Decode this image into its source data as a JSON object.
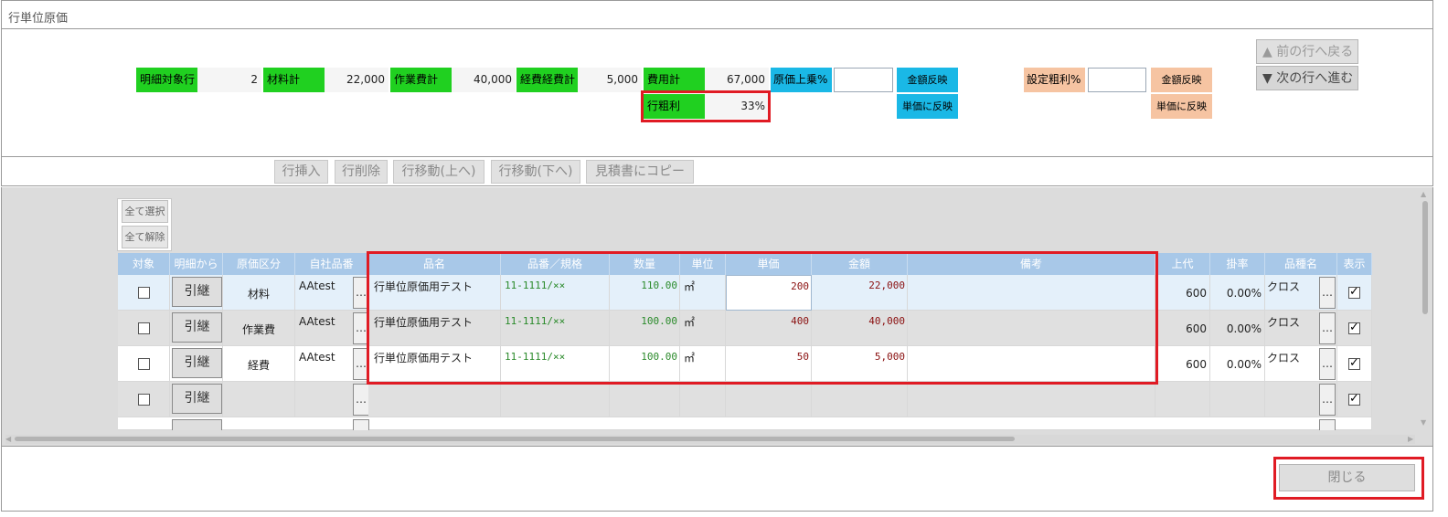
{
  "window": {
    "title": "行単位原価"
  },
  "summary": {
    "detail_rows_label": "明細対象行",
    "detail_rows_value": "2",
    "material_label": "材料計",
    "material_value": "22,000",
    "labor_label": "作業費計",
    "labor_value": "40,000",
    "expense_label": "経費経費計",
    "expense_value": "5,000",
    "cost_total_label": "費用計",
    "cost_total_value": "67,000",
    "markup_label": "原価上乗%",
    "markup_value": "",
    "amount_reflect_label": "金額反映",
    "unit_reflect_label": "単価に反映",
    "gross_label": "行粗利",
    "gross_value": "33%",
    "target_margin_label": "設定粗利%",
    "target_margin_value": "",
    "amount_reflect2_label": "金額反映",
    "unit_reflect2_label": "単価に反映",
    "prev_row_label": "▲ 前の行へ戻る",
    "next_row_label": "▼ 次の行へ進む"
  },
  "toolbar": {
    "insert_label": "行挿入",
    "delete_label": "行削除",
    "move_up_label": "行移動(上へ)",
    "move_down_label": "行移動(下へ)",
    "copy_label": "見積書にコピー"
  },
  "selection": {
    "select_all": "全て選択",
    "deselect_all": "全て解除"
  },
  "grid": {
    "headers": {
      "target": "対象",
      "from_detail": "明細から",
      "cost_type": "原価区分",
      "own_code": "自社品番",
      "name": "品名",
      "spec": "品番／規格",
      "qty": "数量",
      "unit": "単位",
      "unit_price": "単価",
      "amount": "金額",
      "note": "備考",
      "list_price": "上代",
      "rate": "掛率",
      "category": "品種名",
      "show": "表示"
    },
    "rows": [
      {
        "btn": "引継",
        "cost_type": "材料",
        "own_code": "AAtest",
        "dots": "…",
        "name": "行単位原価用テスト",
        "spec": "11-1111/××",
        "qty": "110.00",
        "unit": "㎡",
        "unit_price": "200",
        "amount": "22,000",
        "note": "",
        "list_price": "600",
        "rate": "0.00%",
        "category": "クロス",
        "dots2": "…"
      },
      {
        "btn": "引継",
        "cost_type": "作業費",
        "own_code": "AAtest",
        "dots": "…",
        "name": "行単位原価用テスト",
        "spec": "11-1111/××",
        "qty": "100.00",
        "unit": "㎡",
        "unit_price": "400",
        "amount": "40,000",
        "note": "",
        "list_price": "600",
        "rate": "0.00%",
        "category": "クロス",
        "dots2": "…"
      },
      {
        "btn": "引継",
        "cost_type": "経費",
        "own_code": "AAtest",
        "dots": "…",
        "name": "行単位原価用テスト",
        "spec": "11-1111/××",
        "qty": "100.00",
        "unit": "㎡",
        "unit_price": "50",
        "amount": "5,000",
        "note": "",
        "list_price": "600",
        "rate": "0.00%",
        "category": "クロス",
        "dots2": "…"
      },
      {
        "btn": "引継",
        "cost_type": "",
        "own_code": "",
        "dots": "…",
        "name": "",
        "spec": "",
        "qty": "",
        "unit": "",
        "unit_price": "",
        "amount": "",
        "note": "",
        "list_price": "",
        "rate": "",
        "category": "",
        "dots2": "…"
      }
    ]
  },
  "footer": {
    "close_label": "閉じる"
  },
  "colors": {
    "green_label": "#20d020",
    "blue_button": "#1ab8e6",
    "peach_button": "#f6c4a2",
    "highlight": "#e01b24",
    "grid_header": "#a8c8e8"
  }
}
